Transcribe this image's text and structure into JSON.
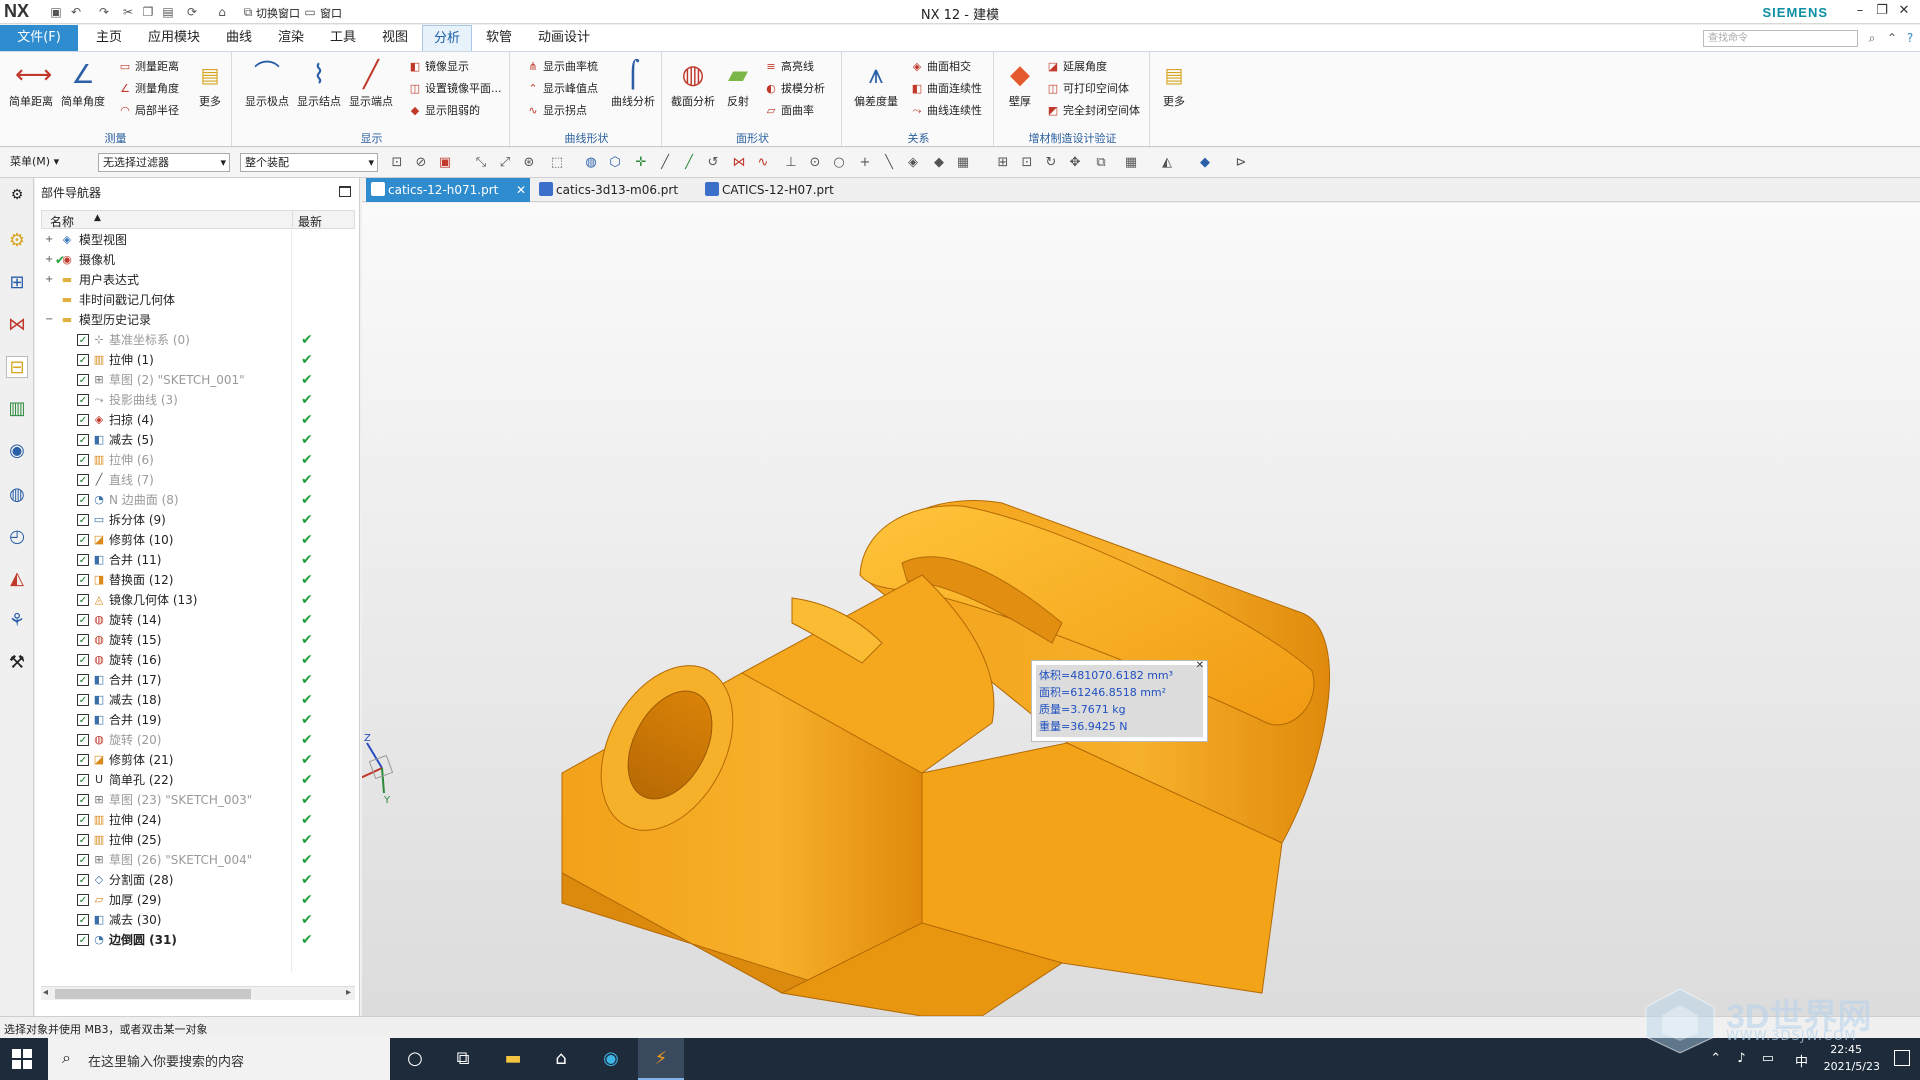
{
  "titlebar": {
    "logo": "NX",
    "switch_window": "切换窗口",
    "window_menu": "窗口",
    "title": "NX 12 - 建模",
    "brand": "SIEMENS"
  },
  "menu": {
    "tabs": [
      "文件(F)",
      "主页",
      "应用模块",
      "曲线",
      "渲染",
      "工具",
      "视图",
      "分析",
      "软管",
      "动画设计"
    ],
    "active": "分析",
    "search_placeholder": "查找命令"
  },
  "ribbon": {
    "measure": {
      "label": "测量",
      "simple_distance": "简单距离",
      "simple_angle": "简单角度",
      "measure_distance": "测量距离",
      "measure_angle": "测量角度",
      "local_radius": "局部半径",
      "more": "更多"
    },
    "display": {
      "label": "显示",
      "show_poles": "显示极点",
      "show_knots": "显示结点",
      "show_endpoints": "显示端点",
      "mirror_display": "镜像显示",
      "set_mirror_plane": "设置镜像平面...",
      "show_tags": "显示阻弱的"
    },
    "curve_shape": {
      "label": "曲线形状",
      "curvature_comb": "显示曲率梳",
      "show_peak": "显示峰值点",
      "show_inflection": "显示拐点",
      "curve_analysis": "曲线分析"
    },
    "face_shape": {
      "label": "面形状",
      "section_analysis": "截面分析",
      "reflection": "反射",
      "highlight": "高亮线",
      "draft_analysis": "拔模分析",
      "face_curvature": "面曲率"
    },
    "relation": {
      "label": "关系",
      "deviation": "偏差度量",
      "face_intersect": "曲面相交",
      "face_continuity": "曲面连续性",
      "curve_continuity": "曲线连续性"
    },
    "additive": {
      "label": "增材制造设计验证",
      "wall_thickness": "壁厚",
      "overhang": "延展角度",
      "printable": "可打印空间体",
      "enclosed": "完全封闭空间体",
      "more": "更多"
    }
  },
  "toolbar2": {
    "menu": "菜单(M)",
    "filter": "无选择过滤器",
    "assembly": "整个装配"
  },
  "navigator": {
    "title": "部件导航器",
    "col_name": "名称",
    "col_latest": "最新",
    "nodes": [
      {
        "label": "模型视图",
        "icon": "model-views-icon",
        "glyph": "◈",
        "color": "#3a7abf"
      },
      {
        "label": "摄像机",
        "icon": "camera-icon",
        "glyph": "◉",
        "color": "#c0392b"
      },
      {
        "label": "用户表达式",
        "icon": "folder-icon",
        "glyph": "▬",
        "color": "#e0b040"
      },
      {
        "label": "非时间戳记几何体",
        "icon": "folder-icon",
        "glyph": "▬",
        "color": "#e0b040"
      },
      {
        "label": "模型历史记录",
        "icon": "folder-open-icon",
        "glyph": "▬",
        "color": "#e0b040"
      }
    ],
    "features": [
      {
        "label": "基准坐标系 (0)",
        "dim": true,
        "icon": "datum-csys-icon",
        "glyph": "⊹",
        "color": "#777"
      },
      {
        "label": "拉伸 (1)",
        "icon": "extrude-icon",
        "glyph": "▥",
        "color": "#d98a1a"
      },
      {
        "label": "草图 (2) \"SKETCH_001\"",
        "dim": true,
        "icon": "sketch-icon",
        "glyph": "⊞",
        "color": "#777"
      },
      {
        "label": "投影曲线 (3)",
        "dim": true,
        "icon": "project-curve-icon",
        "glyph": "⤳",
        "color": "#777"
      },
      {
        "label": "扫掠 (4)",
        "icon": "sweep-icon",
        "glyph": "◈",
        "color": "#c0392b"
      },
      {
        "label": "减去 (5)",
        "icon": "subtract-icon",
        "glyph": "◧",
        "color": "#3a6fa8"
      },
      {
        "label": "拉伸 (6)",
        "dim": true,
        "icon": "extrude-icon",
        "glyph": "▥",
        "color": "#d98a1a"
      },
      {
        "label": "直线 (7)",
        "dim": true,
        "icon": "line-icon",
        "glyph": "╱",
        "color": "#555"
      },
      {
        "label": "N 边曲面 (8)",
        "dim": true,
        "icon": "nside-surface-icon",
        "glyph": "◔",
        "color": "#3a6fa8"
      },
      {
        "label": "拆分体 (9)",
        "icon": "split-body-icon",
        "glyph": "▭",
        "color": "#3a6fa8"
      },
      {
        "label": "修剪体 (10)",
        "icon": "trim-body-icon",
        "glyph": "◪",
        "color": "#d98a1a"
      },
      {
        "label": "合并 (11)",
        "icon": "unite-icon",
        "glyph": "◧",
        "color": "#3a6fa8"
      },
      {
        "label": "替换面 (12)",
        "icon": "replace-face-icon",
        "glyph": "◨",
        "color": "#d98a1a"
      },
      {
        "label": "镜像几何体 (13)",
        "icon": "mirror-geometry-icon",
        "glyph": "◬",
        "color": "#d98a1a"
      },
      {
        "label": "旋转 (14)",
        "icon": "revolve-icon",
        "glyph": "◍",
        "color": "#c0392b"
      },
      {
        "label": "旋转 (15)",
        "icon": "revolve-icon",
        "glyph": "◍",
        "color": "#c0392b"
      },
      {
        "label": "旋转 (16)",
        "icon": "revolve-icon",
        "glyph": "◍",
        "color": "#c0392b"
      },
      {
        "label": "合并 (17)",
        "icon": "unite-icon",
        "glyph": "◧",
        "color": "#3a6fa8"
      },
      {
        "label": "减去 (18)",
        "icon": "subtract-icon",
        "glyph": "◧",
        "color": "#3a6fa8"
      },
      {
        "label": "合并 (19)",
        "icon": "unite-icon",
        "glyph": "◧",
        "color": "#3a6fa8"
      },
      {
        "label": "旋转 (20)",
        "dim": true,
        "icon": "revolve-icon",
        "glyph": "◍",
        "color": "#c0392b"
      },
      {
        "label": "修剪体 (21)",
        "icon": "trim-body-icon",
        "glyph": "◪",
        "color": "#d98a1a"
      },
      {
        "label": "简单孔 (22)",
        "icon": "hole-icon",
        "glyph": "U",
        "color": "#333"
      },
      {
        "label": "草图 (23) \"SKETCH_003\"",
        "dim": true,
        "icon": "sketch-icon",
        "glyph": "⊞",
        "color": "#777"
      },
      {
        "label": "拉伸 (24)",
        "icon": "extrude-icon",
        "glyph": "▥",
        "color": "#d98a1a"
      },
      {
        "label": "拉伸 (25)",
        "icon": "extrude-icon",
        "glyph": "▥",
        "color": "#d98a1a"
      },
      {
        "label": "草图 (26) \"SKETCH_004\"",
        "dim": true,
        "icon": "sketch-icon",
        "glyph": "⊞",
        "color": "#777"
      },
      {
        "label": "分割面 (28)",
        "icon": "divide-face-icon",
        "glyph": "◇",
        "color": "#3a6fa8"
      },
      {
        "label": "加厚 (29)",
        "icon": "thicken-icon",
        "glyph": "▱",
        "color": "#d98a1a"
      },
      {
        "label": "减去 (30)",
        "icon": "subtract-icon",
        "glyph": "◧",
        "color": "#3a6fa8"
      },
      {
        "label": "边倒圆 (31)",
        "bold": true,
        "icon": "edge-blend-icon",
        "glyph": "◔",
        "color": "#3a6fa8"
      }
    ]
  },
  "doc_tabs": [
    "catics-12-h071.prt",
    "catics-3d13-m06.prt",
    "CATICS-12-H07.prt"
  ],
  "tooltip": {
    "volume": "体积=481070.6182 mm³",
    "area": "面积=61246.8518 mm²",
    "mass": "质量=3.7671 kg",
    "weight": "重量=36.9425 N"
  },
  "status": "选择对象并使用 MB3，或者双击某一对象",
  "taskbar": {
    "search": "在这里输入你要搜索的内容",
    "time": "22:45",
    "date": "2021/5/23",
    "ime": "中"
  },
  "watermark": {
    "text": "3D世界网",
    "url": "WWW.3DSJW.COM"
  },
  "colors": {
    "accent": "#2e8ccf",
    "part": "#f2a11a",
    "check": "#22a03a"
  }
}
